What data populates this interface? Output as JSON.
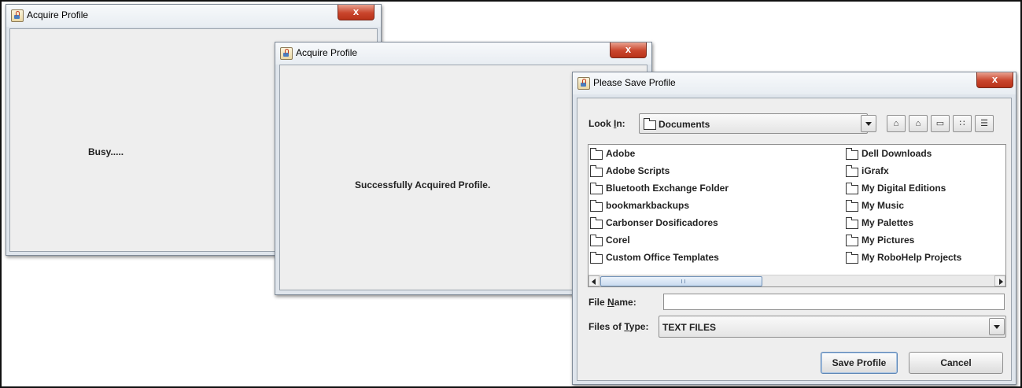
{
  "win1": {
    "title": "Acquire Profile",
    "message": "Busy.....",
    "close_glyph": "x"
  },
  "win2": {
    "title": "Acquire Profile",
    "message": "Successfully Acquired Profile.",
    "close_glyph": "x"
  },
  "dialog": {
    "title": "Please Save Profile",
    "close_glyph": "x",
    "look_in_label_pre": "Look ",
    "look_in_label_key": "I",
    "look_in_label_post": "n:",
    "look_in_value": "Documents",
    "toolbar_icons": [
      "up-one-level-icon",
      "home-icon",
      "new-folder-icon",
      "list-view-icon",
      "details-view-icon"
    ],
    "toolbar_glyphs": [
      "⌂",
      "⌂",
      "▭",
      "∷",
      "☰"
    ],
    "files_left": [
      "Adobe",
      "Adobe Scripts",
      "Bluetooth Exchange Folder",
      "bookmarkbackups",
      "Carbonser Dosificadores",
      "Corel",
      "Custom Office Templates"
    ],
    "files_right": [
      "Dell Downloads",
      "iGrafx",
      "My Digital Editions",
      "My Music",
      "My Palettes",
      "My Pictures",
      "My RoboHelp Projects"
    ],
    "file_name_label_pre": "File ",
    "file_name_label_key": "N",
    "file_name_label_post": "ame:",
    "file_name_value": "",
    "files_of_type_label_pre": "Files of ",
    "files_of_type_label_key": "T",
    "files_of_type_label_post": "ype:",
    "files_of_type_value": "TEXT FILES",
    "save_button": "Save Profile",
    "cancel_button": "Cancel"
  },
  "colors": {
    "close_red": "#c9452c",
    "window_bg": "#eeeeee",
    "border": "#7f8a97"
  }
}
